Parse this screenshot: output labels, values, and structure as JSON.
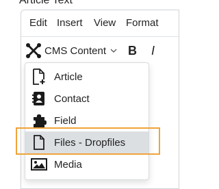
{
  "field": {
    "label": "Article Text"
  },
  "menubar": {
    "items": [
      {
        "label": "Edit"
      },
      {
        "label": "Insert"
      },
      {
        "label": "View"
      },
      {
        "label": "Format"
      }
    ]
  },
  "toolbar": {
    "cms_content_label": "CMS Content",
    "bold_label": "B",
    "italic_label": "I"
  },
  "dropdown": {
    "items": [
      {
        "label": "Article",
        "icon": "file-plus-icon"
      },
      {
        "label": "Contact",
        "icon": "contact-card-icon"
      },
      {
        "label": "Field",
        "icon": "puzzle-piece-icon"
      },
      {
        "label": "Files - Dropfiles",
        "icon": "file-icon",
        "selected": true
      },
      {
        "label": "Media",
        "icon": "image-icon"
      }
    ]
  },
  "colors": {
    "focus_outline": "#f0a33a",
    "selected_bg": "#dcdfe2"
  }
}
